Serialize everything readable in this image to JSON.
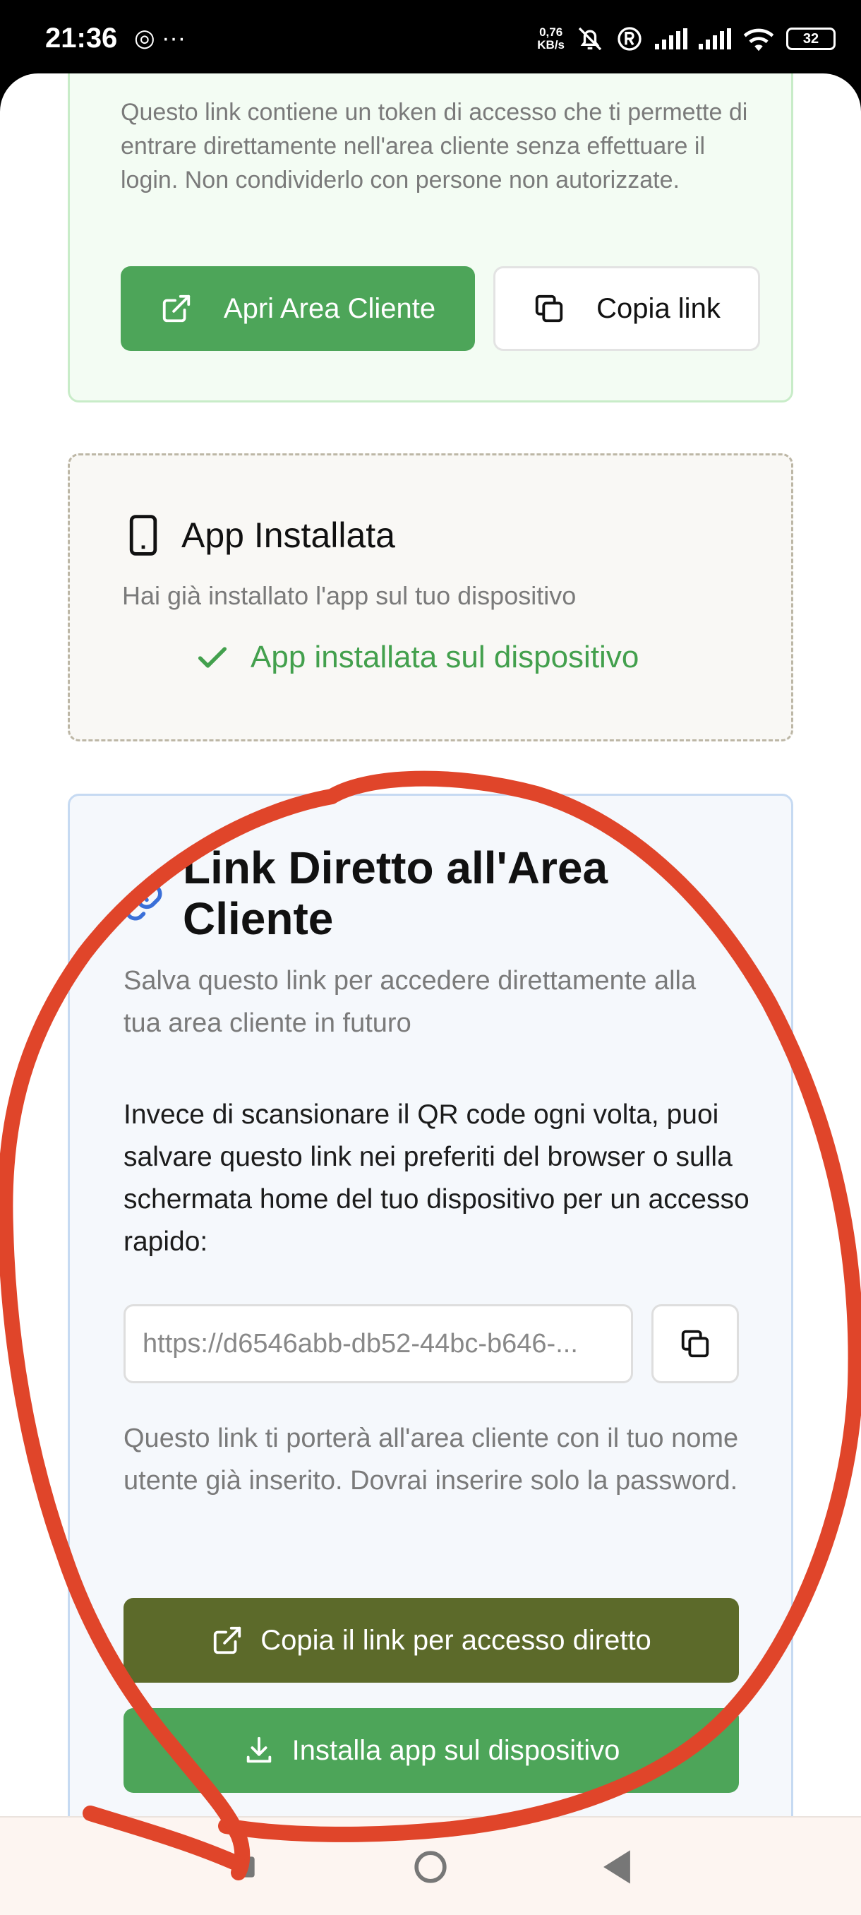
{
  "status_bar": {
    "time": "21:36",
    "left_icons": "◎ ···",
    "speed_top": "0,76",
    "speed_bottom": "KB/s",
    "battery": "32"
  },
  "access_card": {
    "description": "Questo link contiene un token di accesso che ti permette di entrare direttamente nell'area cliente senza effettuare il login. Non condividerlo con persone non autorizzate.",
    "open_button_label": "Apri Area Cliente",
    "copy_button_label": "Copia link"
  },
  "app_card": {
    "title": "App Installata",
    "subtitle": "Hai già installato l'app sul tuo dispositivo",
    "status": "App installata sul dispositivo",
    "status_color": "#43a04d"
  },
  "direct_link_card": {
    "title": "Link Diretto all'Area Cliente",
    "subtitle": "Salva questo link per accedere direttamente alla tua area cliente in futuro",
    "body": "Invece di scansionare il QR code ogni volta, puoi salvare questo link nei preferiti del browser o sulla schermata home del tuo dispositivo per un accesso rapido:",
    "url_value": "https://d6546abb-db52-44bc-b646-...",
    "note": "Questo link ti porterà all'area cliente con il tuo nome utente già inserito. Dovrai inserire solo la password.",
    "direct_button_label": "Copia il link per accesso diretto",
    "install_button_label": "Installa app sul dispositivo"
  },
  "colors": {
    "primary_green": "#4da559",
    "olive": "#5c6a2a",
    "annotation_red": "#e0452a"
  },
  "icons": [
    "external-link-icon",
    "copy-icon",
    "phone-icon",
    "check-icon",
    "link-icon",
    "download-icon",
    "home-nav-icon",
    "back-nav-icon"
  ]
}
